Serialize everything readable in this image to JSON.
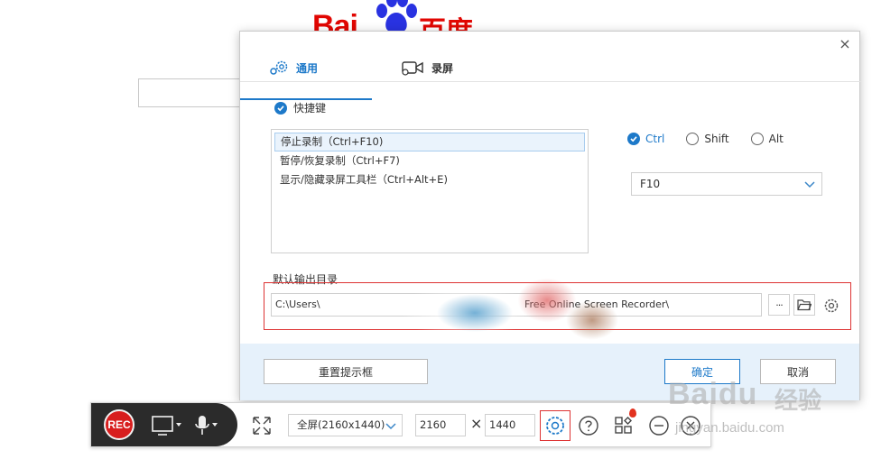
{
  "background": {
    "logo_text": "Bai",
    "logo_cn": "百度"
  },
  "dialog": {
    "close_label": "×",
    "tabs": [
      {
        "label": "通用",
        "icon": "gear-icon",
        "active": true
      },
      {
        "label": "录屏",
        "icon": "video-camera-icon",
        "active": false
      }
    ],
    "hotkeys": {
      "section_title": "快捷键",
      "items": [
        {
          "label": "停止录制（Ctrl+F10)",
          "selected": true
        },
        {
          "label": "暂停/恢复录制（Ctrl+F7)",
          "selected": false
        },
        {
          "label": "显示/隐藏录屏工具栏（Ctrl+Alt+E)",
          "selected": false
        }
      ],
      "modifiers": [
        {
          "label": "Ctrl",
          "checked": true
        },
        {
          "label": "Shift",
          "checked": false
        },
        {
          "label": "Alt",
          "checked": false
        }
      ],
      "key_value": "F10"
    },
    "output": {
      "label": "默认输出目录",
      "path": "C:\\Users\\",
      "path_end": "Free Online Screen Recorder\\",
      "more_label": "···"
    },
    "footer": {
      "reset_label": "重置提示框",
      "ok_label": "确定",
      "cancel_label": "取消"
    }
  },
  "toolbar": {
    "rec_label": "REC",
    "resolution": "全屏(2160x1440)",
    "width": "2160",
    "times_symbol": "×",
    "height": "1440"
  },
  "watermark": {
    "brand": "Baidu",
    "brand_cn": "经验",
    "url": "jingyan.baidu.com"
  },
  "colors": {
    "accent": "#1d79c9",
    "rec_red": "#d81e1e",
    "highlight_border": "#dd3333",
    "footer_bg": "#e6f1fb"
  }
}
